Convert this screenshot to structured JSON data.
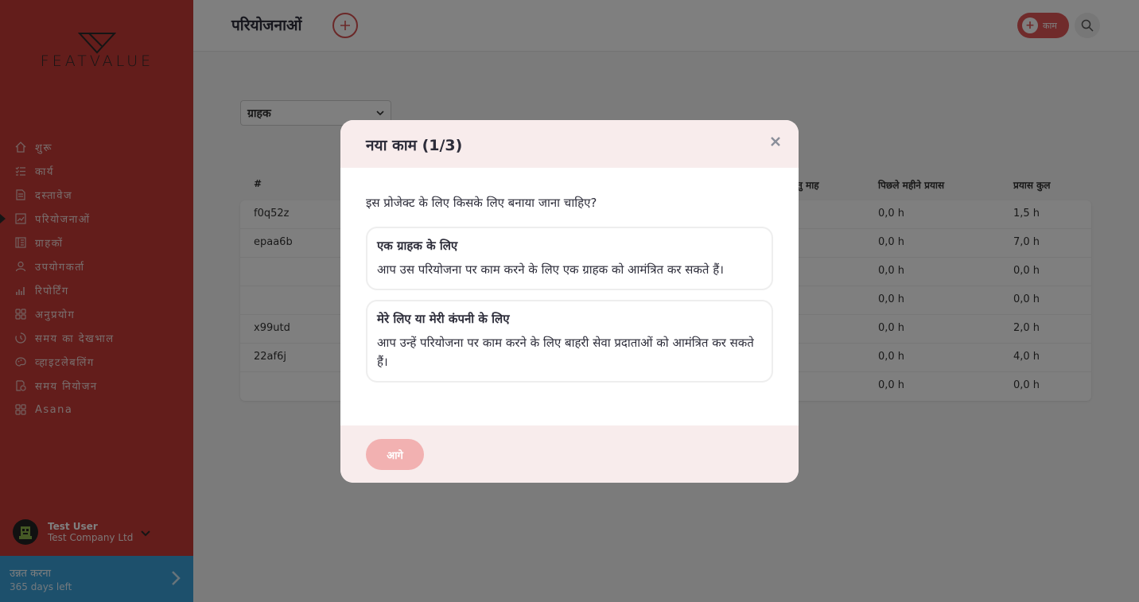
{
  "sidebar": {
    "logo_text": "FEATVALUE",
    "items": [
      {
        "label": "शुरू",
        "icon": "home-icon"
      },
      {
        "label": "कार्य",
        "icon": "task-list-icon"
      },
      {
        "label": "दस्तावेज",
        "icon": "document-icon"
      },
      {
        "label": "परियोजनाओं",
        "icon": "projects-icon",
        "active": true
      },
      {
        "label": "ग्राहकों",
        "icon": "clients-icon"
      },
      {
        "label": "उपयोगकर्ता",
        "icon": "user-icon"
      },
      {
        "label": "रिपोर्टिंग",
        "icon": "reporting-icon"
      },
      {
        "label": "अनुप्रयोग",
        "icon": "apps-grid-icon"
      },
      {
        "label": "समय का देखभाल",
        "icon": "time-tracking-icon"
      },
      {
        "label": "व्हाइटलेबलिंग",
        "icon": "whitelabel-icon"
      },
      {
        "label": "समय नियोजन",
        "icon": "time-planning-icon"
      },
      {
        "label": "Asana",
        "icon": "asana-grid-icon"
      }
    ],
    "user": {
      "name": "Test User",
      "company": "Test Company Ltd"
    },
    "upgrade": {
      "title": "उन्नत करना",
      "subtitle": "365 days left"
    }
  },
  "header": {
    "title": "परियोजनाओं",
    "task_button_label": "काम"
  },
  "filter": {
    "selected": "ग्राहक"
  },
  "table": {
    "columns": [
      "#",
      "तु माह",
      "पिछले महीने प्रयास",
      "प्रयास कुल"
    ],
    "rows": [
      {
        "id": "f0q52z",
        "c2": "",
        "last_month": "0,0 h",
        "total": "1,5 h"
      },
      {
        "id": "epaa6b",
        "c2": "",
        "last_month": "0,0 h",
        "total": "7,0 h"
      },
      {
        "id": "",
        "c2": "",
        "last_month": "0,0 h",
        "total": "0,0 h"
      },
      {
        "id": "",
        "c2": "",
        "last_month": "0,0 h",
        "total": "0,0 h"
      },
      {
        "id": "x99utd",
        "c2": "",
        "last_month": "0,0 h",
        "total": "2,0 h"
      },
      {
        "id": "22af6j",
        "c2": "",
        "last_month": "0,0 h",
        "total": "4,0 h"
      },
      {
        "id": "",
        "c2": "",
        "last_month": "0,0 h",
        "total": "0,0 h"
      }
    ]
  },
  "modal": {
    "title": "नया काम (1/3)",
    "question": "इस प्रोजेक्ट के लिए किसके लिए बनाया जाना चाहिए?",
    "options": [
      {
        "title": "एक ग्राहक के लिए",
        "description": "आप उस परियोजना पर काम करने के लिए एक ग्राहक को आमंत्रित कर सकते हैं।"
      },
      {
        "title": "मेरे लिए या मेरी कंपनी के लिए",
        "description": "आप उन्हें परियोजना पर काम करने के लिए बाहरी सेवा प्रदाताओं को आमंत्रित कर सकते हैं।"
      }
    ],
    "next_label": "आगे"
  },
  "colors": {
    "sidebar": "#c63a36",
    "accent": "#e05757",
    "upgrade": "#3aa0d8",
    "modal_header": "#f8ecec",
    "next_disabled": "#f2b1b1"
  }
}
